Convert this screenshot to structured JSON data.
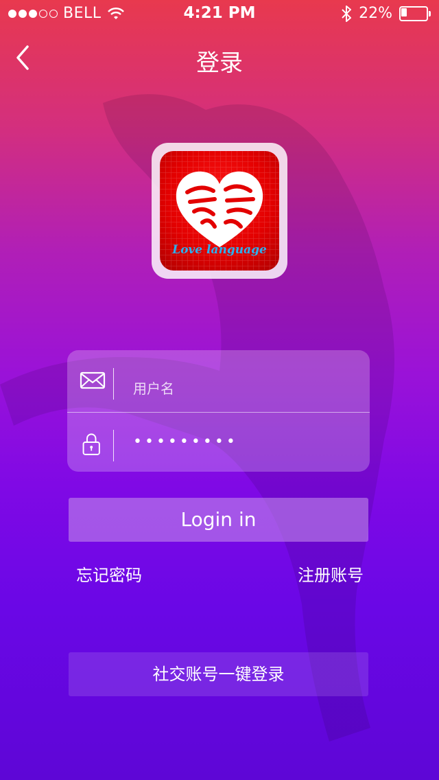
{
  "status_bar": {
    "carrier": "BELL",
    "signal_bars_filled": 3,
    "signal_bars_total": 5,
    "time": "4:21 PM",
    "battery_percent_text": "22%",
    "battery_level": 0.22,
    "wifi_icon": "wifi-icon",
    "bluetooth_icon": "bluetooth-icon"
  },
  "nav": {
    "title": "登录",
    "back_icon": "chevron-left-icon"
  },
  "logo": {
    "caption": "Love language",
    "glyphs": "爱语"
  },
  "form": {
    "username_placeholder": "用户名",
    "username_icon": "envelope-icon",
    "password_value": "•••••••••",
    "password_icon": "lock-icon"
  },
  "actions": {
    "login_label": "Login in",
    "forgot_label": "忘记密码",
    "register_label": "注册账号",
    "social_label": "社交账号一键登录"
  },
  "colors": {
    "gradient_top": "#e8394e",
    "gradient_mid": "#9a12d8",
    "gradient_bottom": "#5e06d6",
    "logo_red": "#e30000",
    "logo_caption": "#2bb0ef"
  }
}
